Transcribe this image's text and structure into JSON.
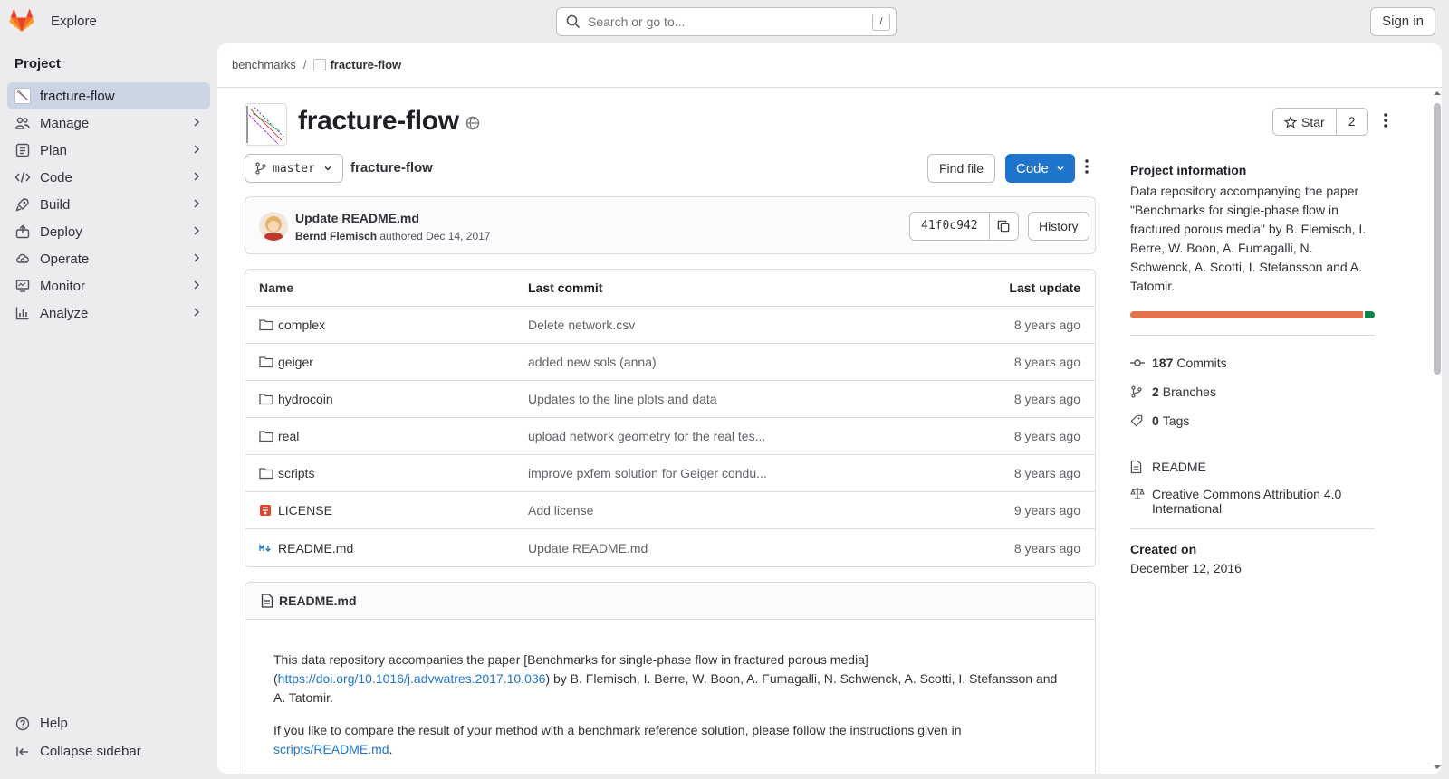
{
  "topbar": {
    "explore_label": "Explore",
    "search_placeholder": "Search or go to...",
    "search_shortcut": "/",
    "signin_label": "Sign in"
  },
  "sidebar": {
    "heading": "Project",
    "items": [
      {
        "label": "fracture-flow",
        "icon": "project-avatar-icon",
        "active": true
      },
      {
        "label": "Manage",
        "icon": "users-icon"
      },
      {
        "label": "Plan",
        "icon": "planning-icon"
      },
      {
        "label": "Code",
        "icon": "code-icon"
      },
      {
        "label": "Build",
        "icon": "rocket-icon"
      },
      {
        "label": "Deploy",
        "icon": "deploy-icon"
      },
      {
        "label": "Operate",
        "icon": "cloud-gear-icon"
      },
      {
        "label": "Monitor",
        "icon": "monitor-icon"
      },
      {
        "label": "Analyze",
        "icon": "chart-icon"
      }
    ],
    "help_label": "Help",
    "collapse_label": "Collapse sidebar"
  },
  "breadcrumb": {
    "parent": "benchmarks",
    "separator": "/",
    "current": "fracture-flow"
  },
  "project": {
    "title": "fracture-flow",
    "star_label": "Star",
    "star_count": "2"
  },
  "repo": {
    "branch": "master",
    "path": "fracture-flow",
    "find_file_label": "Find file",
    "code_label": "Code"
  },
  "last_commit": {
    "title": "Update README.md",
    "author": "Bernd Flemisch",
    "authored_text": "authored",
    "date": "Dec 14, 2017",
    "sha": "41f0c942",
    "history_label": "History"
  },
  "tree": {
    "headers": {
      "name": "Name",
      "last_commit": "Last commit",
      "last_update": "Last update"
    },
    "rows": [
      {
        "name": "complex",
        "type": "folder",
        "message": "Delete network.csv",
        "date": "8 years ago"
      },
      {
        "name": "geiger",
        "type": "folder",
        "message": "added new sols (anna)",
        "date": "8 years ago"
      },
      {
        "name": "hydrocoin",
        "type": "folder",
        "message": "Updates to the line plots and data",
        "date": "8 years ago"
      },
      {
        "name": "real",
        "type": "folder",
        "message": "upload network geometry for the real tes...",
        "date": "8 years ago"
      },
      {
        "name": "scripts",
        "type": "folder",
        "message": "improve pxfem solution for Geiger condu...",
        "date": "8 years ago"
      },
      {
        "name": "LICENSE",
        "type": "license",
        "message": "Add license",
        "date": "9 years ago"
      },
      {
        "name": "README.md",
        "type": "markdown",
        "message": "Update README.md",
        "date": "8 years ago"
      }
    ]
  },
  "readme": {
    "filename": "README.md",
    "p1_a": "This data repository accompanies the paper [Benchmarks for single-phase flow in fractured porous media] (",
    "p1_link": "https://doi.org/10.1016/j.advwatres.2017.10.036",
    "p1_b": ") by B. Flemisch, I. Berre, W. Boon, A. Fumagalli, N. Schwenck, A. Scotti, I. Stefansson and A. Tatomir.",
    "p2_a": "If you like to compare the result of your method with a benchmark reference solution, please follow the instructions given in ",
    "p2_link": "scripts/README.md",
    "p2_b": "."
  },
  "info": {
    "heading": "Project information",
    "description": "Data repository accompanying the paper \"Benchmarks for single-phase flow in fractured porous media\" by B. Flemisch, I. Berre, W. Boon, A. Fumagalli, N. Schwenck, A. Scotti, I. Stefansson and A. Tatomir.",
    "languages": [
      {
        "share": 0.96,
        "color": "#e2734a"
      },
      {
        "share": 0.04,
        "color": "#108548"
      }
    ],
    "commits_count": "187",
    "commits_label": "Commits",
    "branches_count": "2",
    "branches_label": "Branches",
    "tags_count": "0",
    "tags_label": "Tags",
    "readme_label": "README",
    "license_label": "Creative Commons Attribution 4.0 International",
    "created_heading": "Created on",
    "created_date": "December 12, 2016"
  },
  "colors": {
    "accent": "#1f75cb",
    "active_nav": "#cbd5e4"
  }
}
